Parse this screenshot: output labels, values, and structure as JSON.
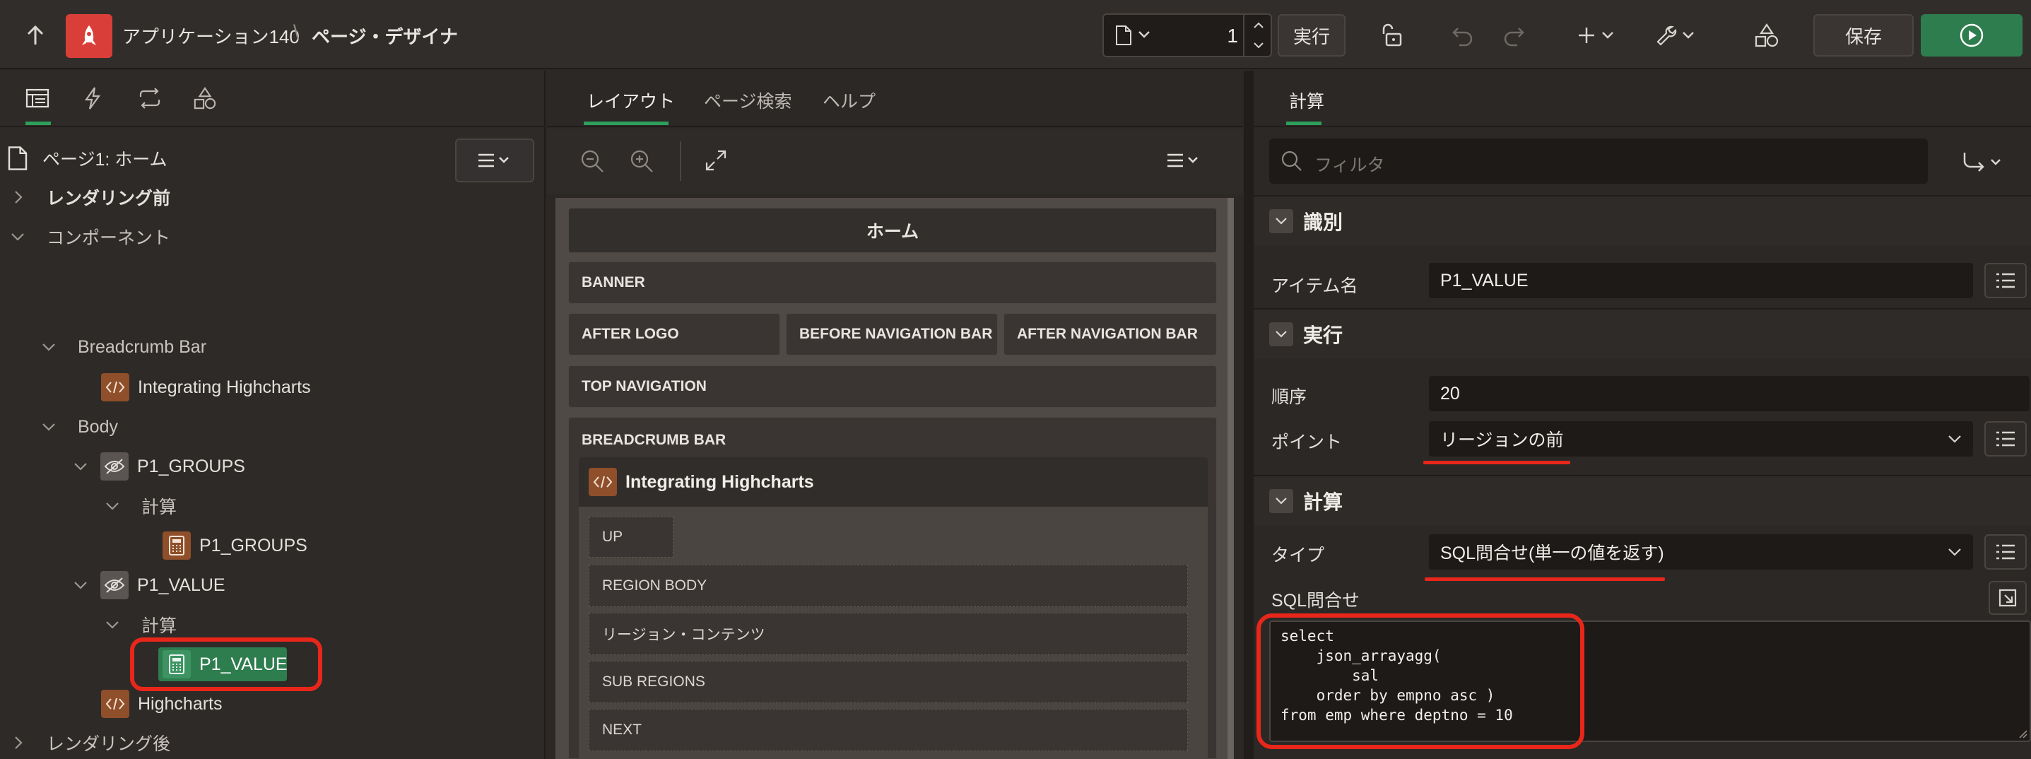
{
  "header": {
    "app_name": "アプリケーション140",
    "separator": "\\",
    "page_designer": "ページ・デザイナ",
    "page_number": "1",
    "run_label": "実行",
    "save_label": "保存"
  },
  "left": {
    "page_title": "ページ1: ホーム",
    "tree": {
      "before_rendering": "レンダリング前",
      "components": "コンポーネント",
      "breadcrumb_bar": "Breadcrumb Bar",
      "integrating": "Integrating Highcharts",
      "body": "Body",
      "p1_groups": "P1_GROUPS",
      "calc1": "計算",
      "p1_groups_calc": "P1_GROUPS",
      "p1_value": "P1_VALUE",
      "calc2": "計算",
      "p1_value_calc": "P1_VALUE",
      "highcharts": "Highcharts",
      "after_rendering": "レンダリング後"
    }
  },
  "middle": {
    "tabs": [
      "レイアウト",
      "ページ検索",
      "ヘルプ"
    ],
    "home": "ホーム",
    "banner": "BANNER",
    "after_logo": "AFTER LOGO",
    "before_nav": "BEFORE NAVIGATION BAR",
    "after_nav": "AFTER NAVIGATION BAR",
    "top_nav": "TOP NAVIGATION",
    "breadcrumb_bar": "BREADCRUMB BAR",
    "region_title": "Integrating Highcharts",
    "up": "UP",
    "region_body": "REGION BODY",
    "region_content": "リージョン・コンテンツ",
    "sub_regions": "SUB REGIONS",
    "next": "NEXT"
  },
  "right": {
    "tab": "計算",
    "filter_placeholder": "フィルタ",
    "section_identification": "識別",
    "item_name_label": "アイテム名",
    "item_name_value": "P1_VALUE",
    "section_execution": "実行",
    "sequence_label": "順序",
    "sequence_value": "20",
    "point_label": "ポイント",
    "point_value": "リージョンの前",
    "section_computation": "計算",
    "type_label": "タイプ",
    "type_value": "SQL問合せ(単一の値を返す)",
    "sql_label": "SQL問合せ",
    "sql_code": "select\n    json_arrayagg(\n        sal\n    order by empno asc )\nfrom emp where deptno = 10"
  },
  "colors": {
    "accent_green": "#2e7d4f",
    "app_red": "#d93f38",
    "annotation_red": "#e8271a"
  }
}
